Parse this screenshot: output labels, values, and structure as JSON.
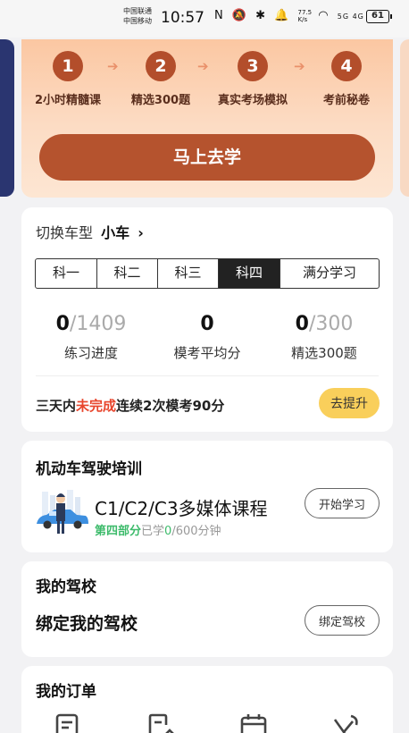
{
  "status_bar": {
    "carrier_1": "中国联通",
    "carrier_2": "中国移动",
    "time": "10:57",
    "icons_text": "N 🔕 ✱ 🔔",
    "net_speed_top": "77.5",
    "net_speed_bottom": "K/s",
    "signal_text": "5G 4G",
    "battery": "61"
  },
  "banner": {
    "steps": [
      {
        "num": "1",
        "label": "2小时精髓课"
      },
      {
        "num": "2",
        "label": "精选300题"
      },
      {
        "num": "3",
        "label": "真实考场模拟"
      },
      {
        "num": "4",
        "label": "考前秘卷"
      }
    ],
    "arrow": "➔",
    "cta": "马上去学"
  },
  "subject_card": {
    "switch_label": "切换车型",
    "car_type": "小车",
    "chevron": "›",
    "tabs": [
      "科一",
      "科二",
      "科三",
      "科四",
      "满分学习"
    ],
    "active_tab": "科四",
    "stats": [
      {
        "current": "0",
        "total": "/1409",
        "label": "练习进度"
      },
      {
        "current": "0",
        "total": "",
        "label": "模考平均分"
      },
      {
        "current": "0",
        "total": "/300",
        "label": "精选300题"
      }
    ],
    "promo_prefix": "三天内",
    "promo_highlight": "未完成",
    "promo_suffix": "连续2次模考90分",
    "promo_button": "去提升"
  },
  "training_card": {
    "title": "机动车驾驶培训",
    "course_name": "C1/C2/C3多媒体课程",
    "part": "第四部分",
    "learned_prefix": "已学",
    "learned_value": "0",
    "learned_suffix": "/600分钟",
    "button": "开始学习"
  },
  "school_card": {
    "title": "我的驾校",
    "bind_text": "绑定我的驾校",
    "button": "绑定驾校"
  },
  "orders_card": {
    "title": "我的订单",
    "icons": [
      "order-list-icon",
      "edit-document-icon",
      "calendar-icon",
      "steering-wheel-icon"
    ]
  },
  "colors": {
    "brand_brown": "#b5532e",
    "promo_red": "#e8452c",
    "accent_yellow": "#f9cf5b",
    "green": "#3dbb6b"
  }
}
